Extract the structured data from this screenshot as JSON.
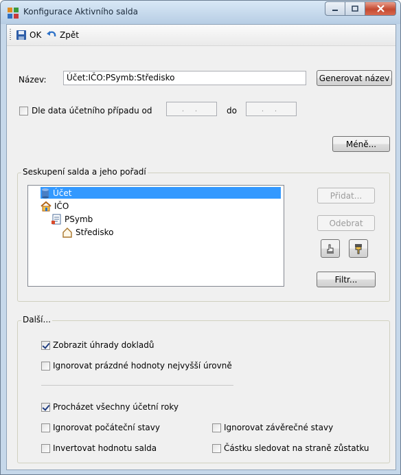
{
  "window": {
    "title": "Konfigurace Aktivního salda",
    "icon": "app-puzzle-icon"
  },
  "toolbar": {
    "ok_label": "OK",
    "back_label": "Zpět"
  },
  "name_row": {
    "label": "Název:",
    "value": "Účet:IČO:PSymb:Středisko",
    "generate_label": "Generovat název"
  },
  "date_row": {
    "label": "Dle data účetního případu od",
    "from_value": ". .",
    "to_label": "do",
    "to_value": ". ."
  },
  "less_button": "Méně...",
  "grouping": {
    "legend": "Seskupení salda a jeho pořadí",
    "tree": [
      {
        "label": "Účet",
        "icon": "cylinder-icon",
        "selected": true
      },
      {
        "label": "IČO",
        "icon": "house-icon"
      },
      {
        "label": "PSymb",
        "icon": "document-icon"
      },
      {
        "label": "Středisko",
        "icon": "house-outline-icon"
      }
    ],
    "add_label": "Přidat...",
    "remove_label": "Odebrat",
    "filter_label": "Filtr..."
  },
  "more": {
    "legend": "Další...",
    "show_payments": {
      "label": "Zobrazit úhrady dokladů",
      "checked": true
    },
    "ignore_empty_top": {
      "label": "Ignorovat prázdné hodnoty nejvyšší úrovně",
      "checked": false
    },
    "browse_all_years": {
      "label": "Procházet všechny účetní roky",
      "checked": true
    },
    "ignore_initial": {
      "label": "Ignorovat počáteční stavy",
      "checked": false
    },
    "ignore_final": {
      "label": "Ignorovat závěrečné stavy",
      "checked": false
    },
    "invert_balance": {
      "label": "Invertovat hodnotu salda",
      "checked": false
    },
    "track_amount_on_balance_side": {
      "label": "Částku sledovat na straně zůstatku",
      "checked": false
    }
  }
}
